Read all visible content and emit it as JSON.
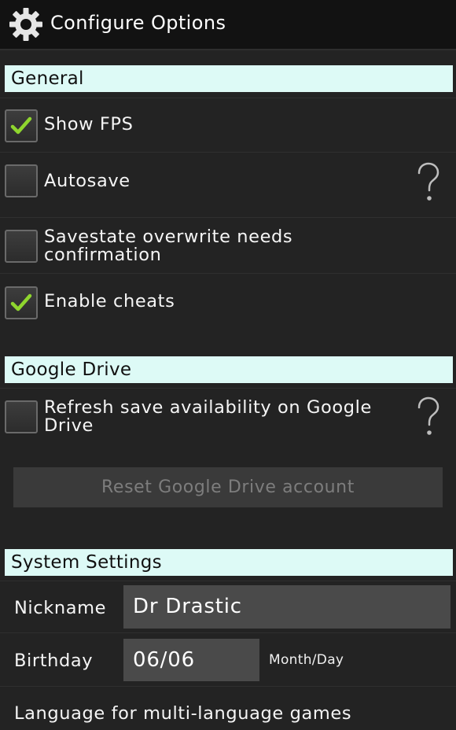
{
  "app_bar": {
    "title": "Configure Options",
    "icon": "gear-icon"
  },
  "general": {
    "header": "General",
    "options": [
      {
        "label": "Show FPS",
        "checked": true,
        "help": false
      },
      {
        "label": "Autosave",
        "checked": false,
        "help": true
      },
      {
        "label_line1": "Savestate overwrite needs",
        "label_line2": "confirmation",
        "checked": false,
        "help": false
      },
      {
        "label": "Enable cheats",
        "checked": true,
        "help": false
      }
    ]
  },
  "google_drive": {
    "header": "Google Drive",
    "refresh_line1": "Refresh save availability on Google",
    "refresh_line2": "Drive",
    "refresh_checked": false,
    "reset_button": "Reset Google Drive account"
  },
  "system_settings": {
    "header": "System Settings",
    "nickname_label": "Nickname",
    "nickname_value": "Dr Drastic",
    "birthday_label": "Birthday",
    "birthday_value": "06/06",
    "birthday_hint": "Month/Day",
    "language_label": "Language for multi-language games"
  },
  "colors": {
    "accent_check": "#8fd62e",
    "section_header_bg": "#ddfaf6",
    "background": "#232323"
  }
}
